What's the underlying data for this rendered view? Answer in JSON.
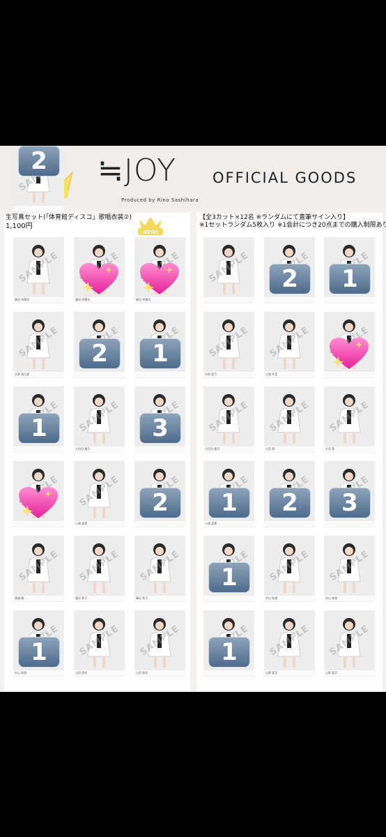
{
  "header": {
    "crown_text": "JOY",
    "brand_name": "≒JOY",
    "brand_sub": "Produced by Rino Sashihara",
    "goods_title": "OFFICIAL GOODS"
  },
  "left_panel": {
    "title": "生写真セット(「体育館ディスコ」歌唱衣装②)",
    "price": "1,100円",
    "new_badge": "NEW!"
  },
  "right_panel": {
    "line1": "【全3カット×12名 ※ランダムにて直筆サイン入り】",
    "line2": "※1セットランダム5枚入り ※1会計につき20点までの購入制限あり"
  },
  "cards": [
    {
      "caption": "藤田 琴葉也",
      "overlay": ""
    },
    {
      "caption": "藤田 琴葉也",
      "overlay": "heart"
    },
    {
      "caption": "藤田 琴葉也",
      "overlay": "heart"
    },
    {
      "caption": "",
      "overlay": ""
    },
    {
      "caption": "",
      "overlay": "2"
    },
    {
      "caption": "",
      "overlay": "1"
    },
    {
      "caption": "天野 香乃愛",
      "overlay": ""
    },
    {
      "caption": "",
      "overlay": "2"
    },
    {
      "caption": "",
      "overlay": "1"
    },
    {
      "caption": "市原 愛弓",
      "overlay": ""
    },
    {
      "caption": "江角 怜音",
      "overlay": ""
    },
    {
      "caption": "",
      "overlay": "heart"
    },
    {
      "caption": "",
      "overlay": "1"
    },
    {
      "caption": "大信田 美月",
      "overlay": ""
    },
    {
      "caption": "",
      "overlay": "3"
    },
    {
      "caption": "大信田 美月",
      "overlay": ""
    },
    {
      "caption": "大西 葵",
      "overlay": ""
    },
    {
      "caption": "大西 葵",
      "overlay": ""
    },
    {
      "caption": "",
      "overlay": "heart"
    },
    {
      "caption": "小澤 愛実",
      "overlay": ""
    },
    {
      "caption": "",
      "overlay": "2"
    },
    {
      "caption": "小澤 愛実",
      "overlay": "1"
    },
    {
      "caption": "",
      "overlay": "2"
    },
    {
      "caption": "",
      "overlay": "3"
    },
    {
      "caption": "髙橋 舞",
      "overlay": ""
    },
    {
      "caption": "藤沢 莉子",
      "overlay": ""
    },
    {
      "caption": "藤沢 莉子",
      "overlay": ""
    },
    {
      "caption": "",
      "overlay": "1"
    },
    {
      "caption": "村山 結香",
      "overlay": ""
    },
    {
      "caption": "村山 結香",
      "overlay": ""
    },
    {
      "caption": "村山 結香",
      "overlay": "1"
    },
    {
      "caption": "山田 杏佳",
      "overlay": ""
    },
    {
      "caption": "山田 杏佳",
      "overlay": ""
    },
    {
      "caption": "",
      "overlay": "1"
    },
    {
      "caption": "山野 愛月",
      "overlay": ""
    },
    {
      "caption": "山野 愛月",
      "overlay": ""
    },
    {
      "caption": "",
      "overlay": "2"
    }
  ],
  "sample_text": "SAMPLE",
  "colors": {
    "page_bg": "#000000",
    "sheet_bg": "#f2f1f0",
    "crown": "#f5de5a",
    "number_box": "#5a7696",
    "heart": "#ff4fb0"
  }
}
